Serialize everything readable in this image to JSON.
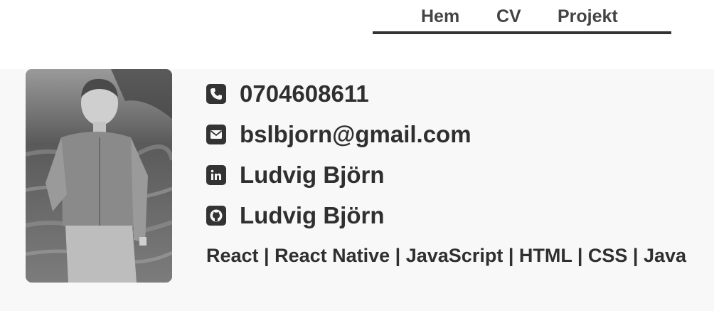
{
  "nav": {
    "items": [
      {
        "label": "Hem"
      },
      {
        "label": "CV"
      },
      {
        "label": "Projekt"
      }
    ]
  },
  "profile": {
    "photo_icon": "portrait-photo"
  },
  "contacts": [
    {
      "icon": "phone-icon",
      "text": "0704608611"
    },
    {
      "icon": "envelope-icon",
      "text": "bslbjorn@gmail.com"
    },
    {
      "icon": "linkedin-icon",
      "text": "Ludvig Björn"
    },
    {
      "icon": "github-icon",
      "text": "Ludvig Björn"
    }
  ],
  "skills": "React | React Native | JavaScript | HTML | CSS | Java",
  "colors": {
    "text": "#333333",
    "content_background": "#f8f8f8",
    "nav_underline": "#333333"
  }
}
